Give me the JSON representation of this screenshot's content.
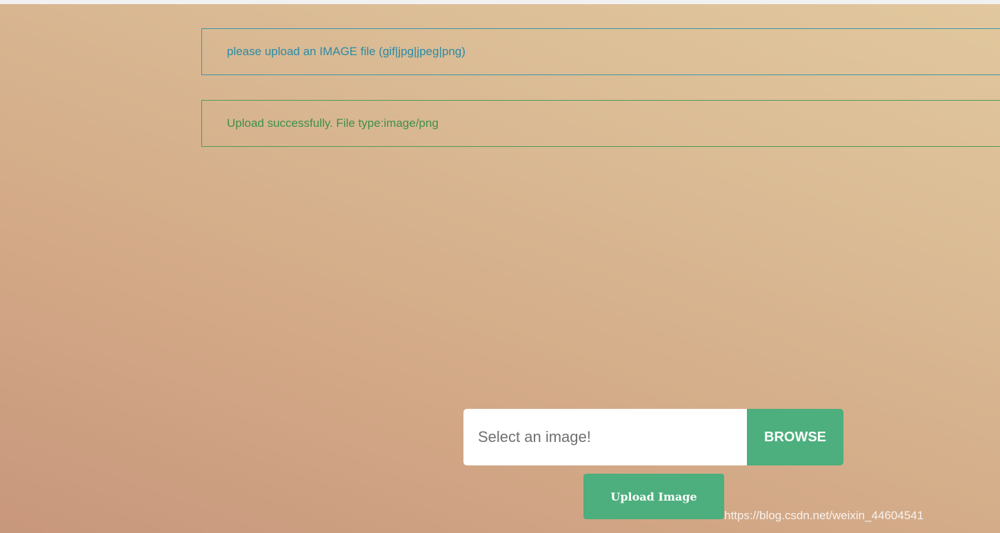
{
  "alerts": {
    "info": "please upload an IMAGE file (gif|jpg|jpeg|png)",
    "success": "Upload successfully. File type:image/png"
  },
  "form": {
    "file_placeholder": "Select an image!",
    "browse_label": "BROWSE",
    "upload_label": "Upload Image"
  },
  "watermark": "https://blog.csdn.net/weixin_44604541",
  "colors": {
    "accent_green": "#4caf7d",
    "info_text": "#2a8ba5",
    "success_text": "#3f8f4a"
  }
}
